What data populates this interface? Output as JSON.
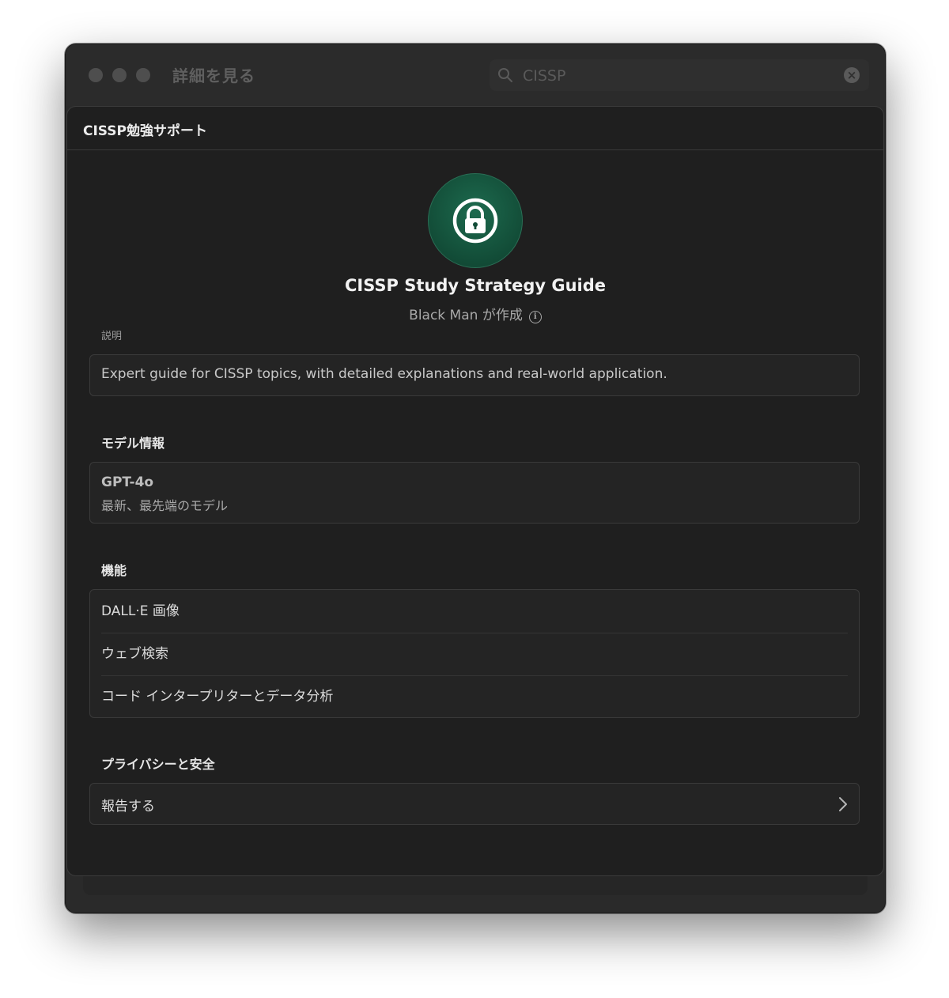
{
  "window": {
    "title": "詳細を見る",
    "search": {
      "value": "CISSP",
      "clear_icon": "x-circle-icon"
    }
  },
  "sheet": {
    "title": "CISSP勉強サポート",
    "gpt": {
      "icon": "lock-icon",
      "name": "CISSP Study Strategy Guide",
      "byline": "Black Man が作成"
    },
    "description": {
      "label": "説明",
      "text": "Expert guide for CISSP topics, with detailed explanations and real-world application."
    },
    "model_info": {
      "label": "モデル情報",
      "name": "GPT-4o",
      "subtitle": "最新、最先端のモデル"
    },
    "capabilities": {
      "label": "機能",
      "items": [
        "DALL·E 画像",
        "ウェブ検索",
        "コード インタープリターとデータ分析"
      ]
    },
    "privacy": {
      "label": "プライバシーと安全",
      "report": "報告する"
    }
  },
  "colors": {
    "avatar_green": "#124c37",
    "sheet_bg": "#1f1f1f"
  }
}
